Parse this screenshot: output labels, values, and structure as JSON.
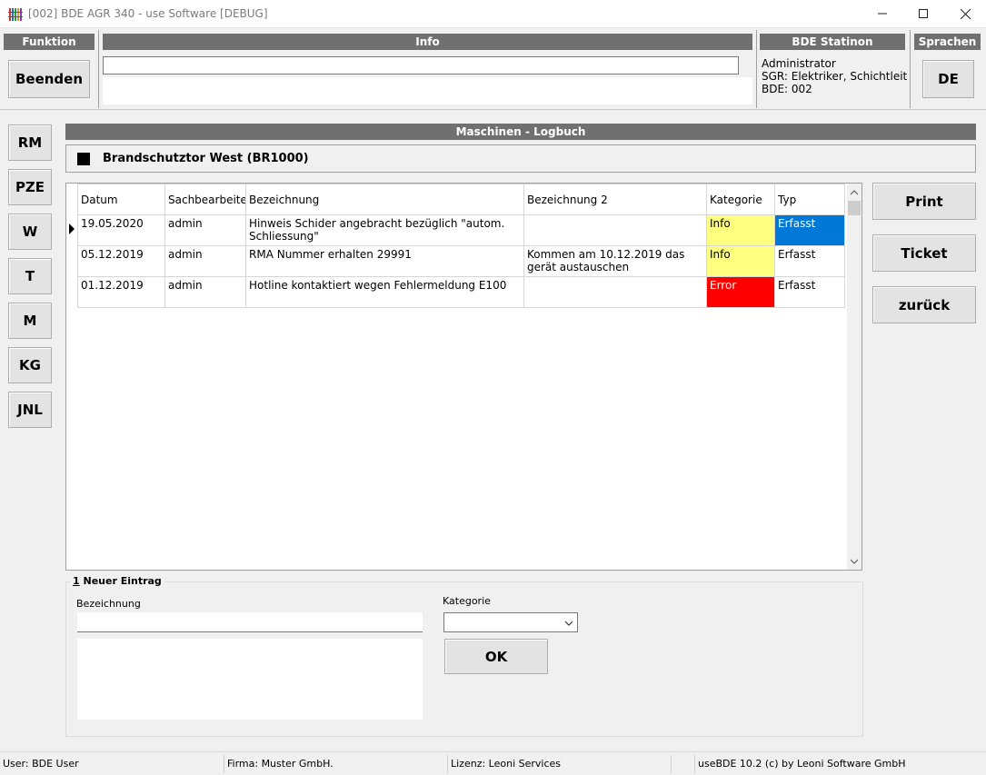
{
  "window": {
    "title": "[002] BDE AGR 340 - use Software [DEBUG]",
    "minimize": "—",
    "maximize": "☐",
    "close": "✕"
  },
  "funktion": {
    "header": "Funktion",
    "beenden": "Beenden"
  },
  "info": {
    "header": "Info",
    "value": ""
  },
  "station": {
    "header": "BDE Statinon",
    "line1": "Administrator",
    "line2": "SGR: Elektriker, Schichtleitun",
    "line3": "BDE: 002"
  },
  "sprachen": {
    "header": "Sprachen",
    "lang": "DE"
  },
  "sidebar": [
    {
      "label": "RM"
    },
    {
      "label": "PZE"
    },
    {
      "label": "W"
    },
    {
      "label": "T"
    },
    {
      "label": "M"
    },
    {
      "label": "KG"
    },
    {
      "label": "JNL"
    }
  ],
  "main": {
    "title": "Maschinen - Logbuch",
    "machine": "Brandschutztor West (BR1000)"
  },
  "grid": {
    "columns": [
      "Datum",
      "Sachbearbeiter",
      "Bezeichnung",
      "Bezeichnung 2",
      "Kategorie",
      "Typ"
    ],
    "rows": [
      {
        "datum": "19.05.2020",
        "sb": "admin",
        "bez": "Hinweis Schider angebracht bezüglich \"autom. Schliessung\"",
        "bez2": "",
        "kat": "Info",
        "typ": "Erfasst"
      },
      {
        "datum": "05.12.2019",
        "sb": "admin",
        "bez": "RMA Nummer erhalten 29991",
        "bez2": "Kommen am 10.12.2019 das gerät austauschen",
        "kat": "Info",
        "typ": "Erfasst"
      },
      {
        "datum": "01.12.2019",
        "sb": "admin",
        "bez": "Hotline kontaktiert wegen Fehlermeldung E100",
        "bez2": "",
        "kat": "Error",
        "typ": "Erfasst"
      }
    ]
  },
  "actions": {
    "print": "Print",
    "ticket": "Ticket",
    "back": "zurück"
  },
  "form": {
    "group_num": "1",
    "group_label": " Neuer Eintrag",
    "bez_label": "Bezeichnung",
    "bez_value": "",
    "kat_label": "Kategorie",
    "kat_value": "",
    "ok": "OK"
  },
  "status": {
    "user": "User: BDE User",
    "firma": "Firma: Muster GmbH.",
    "lizenz": "Lizenz: Leoni Services",
    "empty": "",
    "version": "useBDE 10.2 (c) by Leoni Software GmbH"
  },
  "colors": {
    "header_gray": "#707070",
    "info_yellow": "#ffff80",
    "error_red": "#ff0000",
    "erfasst_blue": "#0078d7"
  }
}
